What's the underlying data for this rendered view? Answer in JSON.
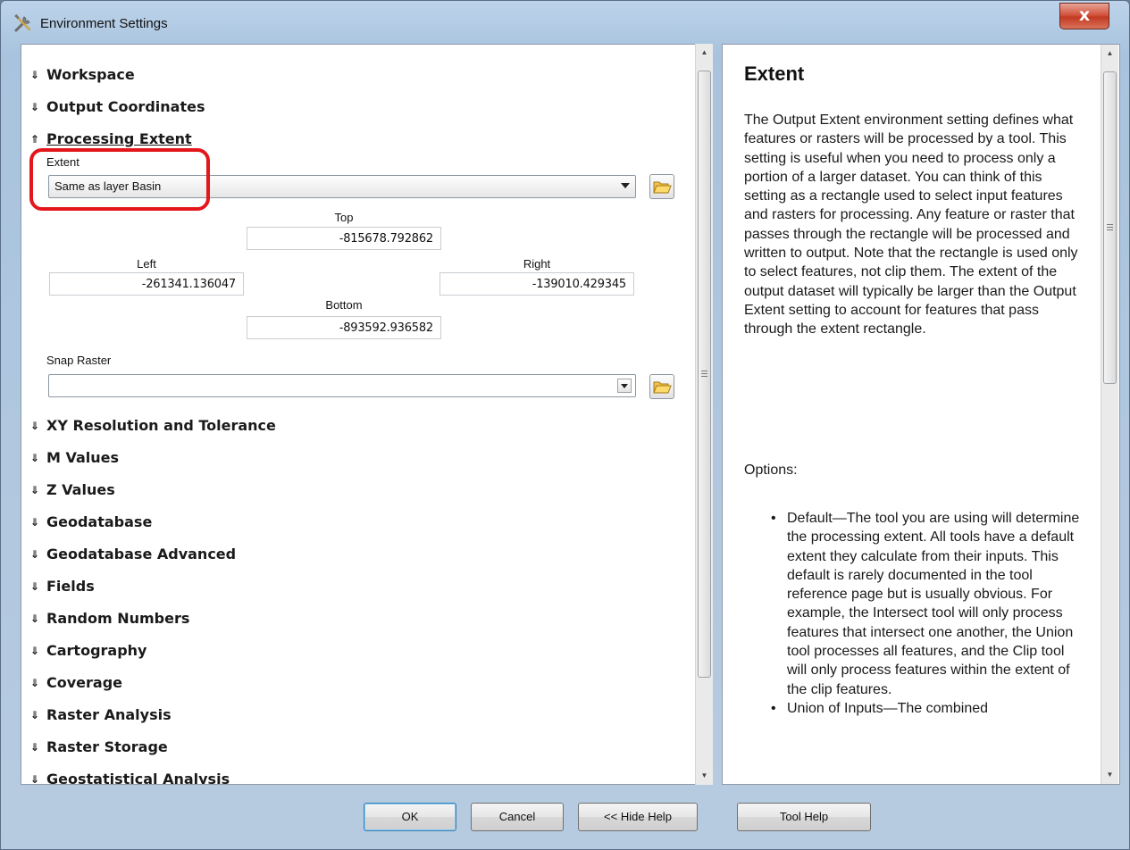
{
  "window": {
    "title": "Environment Settings",
    "close_glyph": "x"
  },
  "sections_top": [
    {
      "label": "Workspace",
      "expanded": false
    },
    {
      "label": "Output Coordinates",
      "expanded": false
    },
    {
      "label": "Processing Extent",
      "expanded": true
    }
  ],
  "processing_extent": {
    "extent_label": "Extent",
    "extent_value": "Same as layer Basin",
    "top_label": "Top",
    "top_value": "-815678.792862",
    "left_label": "Left",
    "left_value": "-261341.136047",
    "right_label": "Right",
    "right_value": "-139010.429345",
    "bottom_label": "Bottom",
    "bottom_value": "-893592.936582",
    "snap_raster_label": "Snap Raster",
    "snap_raster_value": ""
  },
  "sections_bottom": [
    {
      "label": "XY Resolution and Tolerance"
    },
    {
      "label": "M Values"
    },
    {
      "label": "Z Values"
    },
    {
      "label": "Geodatabase"
    },
    {
      "label": "Geodatabase Advanced"
    },
    {
      "label": "Fields"
    },
    {
      "label": "Random Numbers"
    },
    {
      "label": "Cartography"
    },
    {
      "label": "Coverage"
    },
    {
      "label": "Raster Analysis"
    },
    {
      "label": "Raster Storage"
    },
    {
      "label": "Geostatistical Analysis"
    }
  ],
  "help": {
    "title": "Extent",
    "body": "The Output Extent environment setting defines what features or rasters will be processed by a tool. This setting is useful when you need to process only a portion of a larger dataset. You can think of this setting as a rectangle used to select input features and rasters for processing. Any feature or raster that passes through the rectangle will be processed and written to output. Note that the rectangle is used only to select features, not clip them. The extent of the output dataset will typically be larger than the Output Extent setting to account for features that pass through the extent rectangle.",
    "options_heading": "Options:",
    "options": [
      "Default—The tool you are using will determine the processing extent. All tools have a default extent they calculate from their inputs. This default is rarely documented in the tool reference page but is usually obvious. For example, the Intersect tool will only process features that intersect one another, the Union tool processes all features, and the Clip tool will only process features within the extent of the clip features.",
      "Union of Inputs—The combined"
    ]
  },
  "buttons": {
    "ok": "OK",
    "cancel": "Cancel",
    "hide_help": "<< Hide Help",
    "tool_help": "Tool Help"
  },
  "icons": {
    "title": "tools-icon",
    "folder": "open-folder-icon",
    "collapsed": "chevron-double-down-icon",
    "expanded": "chevron-double-up-icon"
  },
  "colors": {
    "highlight": "#e3161c",
    "close": "#c43a22"
  }
}
